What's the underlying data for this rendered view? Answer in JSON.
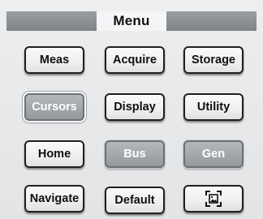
{
  "menu": {
    "title": "Menu"
  },
  "buttons": {
    "meas": "Meas",
    "acquire": "Acquire",
    "storage": "Storage",
    "cursors": "Cursors",
    "display": "Display",
    "utility": "Utility",
    "home": "Home",
    "bus": "Bus",
    "gen": "Gen",
    "navigate": "Navigate",
    "default": "Default",
    "screenshot_icon": "screenshot-icon"
  }
}
